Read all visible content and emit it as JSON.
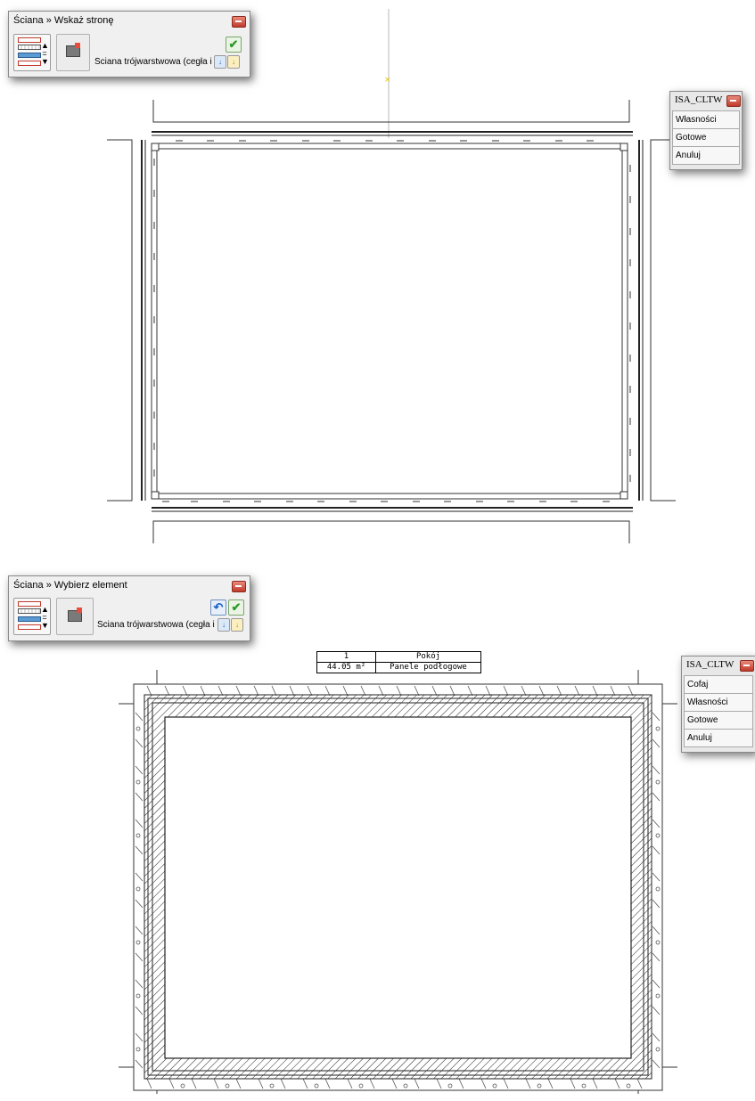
{
  "panel_top": {
    "title": "Ściana » Wskaż stronę",
    "wall_type": "Ściana trójwarstwowa (cegła i bet"
  },
  "menu_top": {
    "title": "ISA_CLTW",
    "items": [
      "Własności",
      "Gotowe",
      "Anuluj"
    ]
  },
  "panel_bottom": {
    "title": "Ściana » Wybierz element",
    "wall_type": "Ściana trójwarstwowa (cegła i bet"
  },
  "menu_bottom": {
    "title": "ISA_CLTW",
    "items": [
      "Cofaj",
      "Własności",
      "Gotowe",
      "Anuluj"
    ]
  },
  "room_label": {
    "number": "1",
    "name": "Pokój",
    "area": "44.05 m²",
    "floor": "Panele podłogowe"
  },
  "icons": {
    "close": "close-icon",
    "ok": "checkmark-icon",
    "undo": "undo-icon",
    "layers": "wall-layers-icon",
    "properties": "properties-icon",
    "prev": "previous-icon",
    "next": "next-icon"
  }
}
